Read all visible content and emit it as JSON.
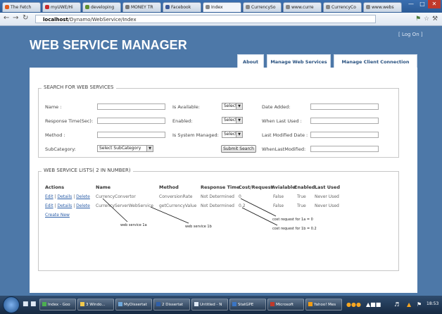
{
  "browser": {
    "tabs": [
      {
        "label": "The Fetch",
        "color": "#e05a1e"
      },
      {
        "label": "myUWE/Hi",
        "color": "#c82a2a"
      },
      {
        "label": "developing",
        "color": "#5f8f2f"
      },
      {
        "label": "MONEY TR",
        "color": "#777777"
      },
      {
        "label": "Facebook",
        "color": "#3b5998"
      },
      {
        "label": "Index",
        "color": "#888888"
      },
      {
        "label": "CurrencySo",
        "color": "#888888"
      },
      {
        "label": "www.curre",
        "color": "#888888"
      },
      {
        "label": "CurrencyCo",
        "color": "#888888"
      },
      {
        "label": "www.webs",
        "color": "#888888"
      }
    ],
    "url_host": "localhost",
    "url_path": "/Dynamo/WebService/Index"
  },
  "app": {
    "title": "WEB SERVICE MANAGER",
    "logon": "[ Log On ]",
    "nav": [
      "About",
      "Manage Web Services",
      "Manage Client Connection Interface"
    ]
  },
  "search": {
    "legend": "SEARCH FOR WEB SERVICES",
    "name_label": "Name :",
    "is_available_label": "Is Available:",
    "date_added_label": "Date Added:",
    "response_time_label": "Response Time(Sec):",
    "enabled_label": "Enabled:",
    "when_last_used_label": "When Last Used :",
    "method_label": "Method :",
    "system_managed_label": "Is System Managed:",
    "last_modified_label": "Last Modified Date :",
    "subcategory_label": "SubCategory:",
    "select_value": "Select",
    "subcategory_value": "Select SubCategory",
    "submit_label": "Submit Search",
    "when_last_modified_label": "WhenLastModified:"
  },
  "list": {
    "legend": "WEB SERVICE LISTS( 2 IN NUMBER)",
    "columns": [
      "Actions",
      "Name",
      "Method",
      "Response Time",
      "Cost/Request",
      "Avialable",
      "Enabled",
      "Last Used"
    ],
    "actions": [
      "Edit",
      "Details",
      "Delete"
    ],
    "rows": [
      {
        "name": "CurrencyConvertor",
        "method": "ConversionRate",
        "response_time": "Not Determined",
        "cost": "0",
        "available": "False",
        "enabled": "True",
        "last_used": "Never Used"
      },
      {
        "name": "CurrencyServerWebService",
        "method": "getCurrencyValue",
        "response_time": "Not Determined",
        "cost": "0.2",
        "available": "False",
        "enabled": "True",
        "last_used": "Never Used"
      }
    ],
    "create_new": "Create New"
  },
  "annotations": {
    "web_service_1a": "web service 1a",
    "web_service_1b": "web service 1b",
    "cost_1a": "cost request for 1a = 0",
    "cost_1b": "cost request for 1b = 0.2"
  },
  "taskbar": {
    "items": [
      "Index - Goo",
      "3 Windo...",
      "MyDissertat",
      "2 Dissertat",
      "Untitled - N",
      "StatGPE",
      "Microsoft",
      "Yahoo! Mes"
    ],
    "clock": "18:53"
  }
}
